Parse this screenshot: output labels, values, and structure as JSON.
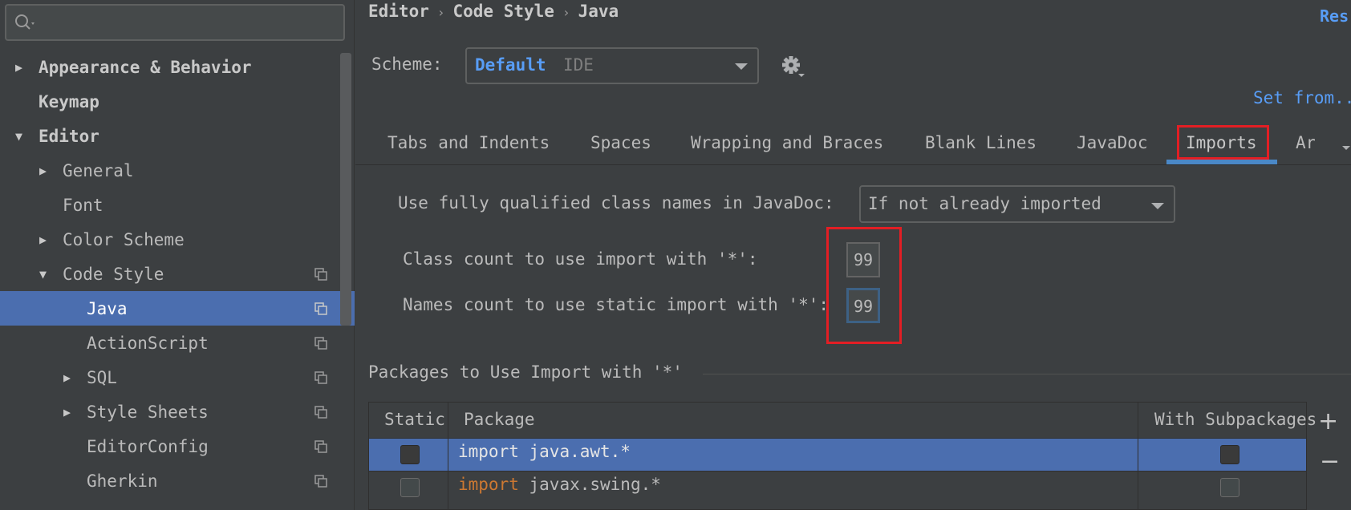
{
  "search": {
    "placeholder": ""
  },
  "sidebar": {
    "items": [
      {
        "label": "Appearance & Behavior",
        "expanded": false
      },
      {
        "label": "Keymap"
      },
      {
        "label": "Editor",
        "expanded": true
      },
      {
        "label": "General",
        "expanded": false
      },
      {
        "label": "Font"
      },
      {
        "label": "Color Scheme",
        "expanded": false
      },
      {
        "label": "Code Style",
        "expanded": true
      },
      {
        "label": "Java",
        "selected": true
      },
      {
        "label": "ActionScript"
      },
      {
        "label": "SQL",
        "expanded": false
      },
      {
        "label": "Style Sheets",
        "expanded": false
      },
      {
        "label": "EditorConfig"
      },
      {
        "label": "Gherkin"
      }
    ]
  },
  "breadcrumb": {
    "part1": "Editor",
    "part2": "Code Style",
    "part3": "Java",
    "separator": "›"
  },
  "reset_label": "Res",
  "scheme": {
    "label": "Scheme:",
    "name": "Default",
    "type": "IDE"
  },
  "set_from": "Set from...",
  "tabs": [
    {
      "label": "Tabs and Indents"
    },
    {
      "label": "Spaces"
    },
    {
      "label": "Wrapping and Braces"
    },
    {
      "label": "Blank Lines"
    },
    {
      "label": "JavaDoc"
    },
    {
      "label": "Imports",
      "active": true
    },
    {
      "label": "Ar"
    }
  ],
  "imports": {
    "fq_label": "Use fully qualified class names in JavaDoc:",
    "fq_value": "If not already imported",
    "class_count_label": "Class count to use import with '*':",
    "class_count_value": "99",
    "names_count_label": "Names count to use static import with '*':",
    "names_count_value": "99"
  },
  "packages": {
    "title": "Packages to Use Import with '*'",
    "headers": {
      "static": "Static",
      "package": "Package",
      "subpackages": "With Subpackages"
    },
    "rows": [
      {
        "keyword": "import",
        "package": "java.awt.*",
        "static": false,
        "subpackages": false,
        "selected": true
      },
      {
        "keyword": "import",
        "package": "javax.swing.*",
        "static": false,
        "subpackages": false,
        "selected": false
      }
    ],
    "add": "+",
    "remove": "−"
  },
  "colors": {
    "accent": "#4b6eaf",
    "link": "#589df6",
    "highlight": "#e31e24",
    "keyword": "#cc7832"
  }
}
